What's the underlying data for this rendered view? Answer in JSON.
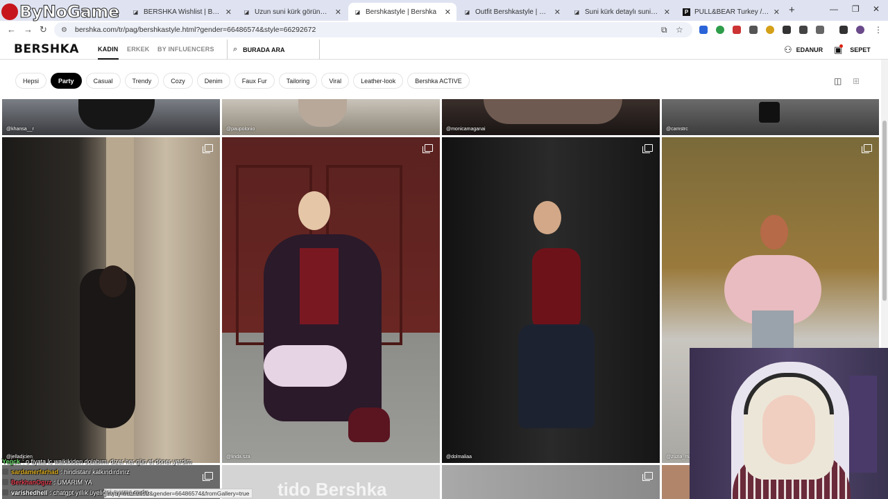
{
  "overlay": {
    "stream_logo": "ByNoGame"
  },
  "browser": {
    "tabs": [
      {
        "title": "BERSHKA Wishlist | Bershka",
        "active": false
      },
      {
        "title": "Uzun suni kürk görünümlü kaba",
        "active": false
      },
      {
        "title": "Bershkastyle | Bershka",
        "active": true
      },
      {
        "title": "Outfit Bershkastyle | Bershka Tü",
        "active": false
      },
      {
        "title": "Suni kürk detaylı suni deri kaba",
        "active": false
      },
      {
        "title": "PULL&BEAR Turkey / Türkiye |",
        "active": false
      }
    ],
    "url": "bershka.com/tr/pag/bershkastyle.html?gender=66486574&style=66292672"
  },
  "header": {
    "brand": "BERSHKA",
    "nav": [
      "KADIN",
      "ERKEK",
      "BY INFLUENCERS"
    ],
    "search_placeholder": "BURADA ARA",
    "account_label": "EDANUR",
    "cart_label": "SEPET"
  },
  "filters": {
    "chips": [
      "Hepsi",
      "Party",
      "Casual",
      "Trendy",
      "Cozy",
      "Denim",
      "Faux Fur",
      "Tailoring",
      "Viral",
      "Leather-look",
      "Bershka ACTIVE"
    ],
    "active": "Party"
  },
  "gallery": {
    "top_row_users": [
      "@khansa__r",
      "@paupolonio",
      "@monicamaganai",
      "@camstrc"
    ],
    "main_row_users": [
      "@jelladjcien",
      "@linda.sza",
      "@dolmaliaa",
      "@zuzia_ma"
    ],
    "partial_text": "tido Bershka"
  },
  "chat": [
    {
      "user": "Yegck",
      "msg": "o fiyata lc waikikiden dolabımı dizer her gün et döner yerdim",
      "color": "#6ee06e"
    },
    {
      "user": "sardamerfarhad",
      "msg": "hindistanı kalkındırdınız",
      "color": "#e0b020"
    },
    {
      "user": "BerkhanOguz",
      "msg": "UMARIM YA",
      "color": "#e04050"
    },
    {
      "user": "varishedhell",
      "msg": "chatgpt yıllık üyeliğini ayırma mıdır",
      "color": "#ffffff"
    }
  ],
  "status_url": "style=66292672&gender=66486574&fromGallery=true"
}
